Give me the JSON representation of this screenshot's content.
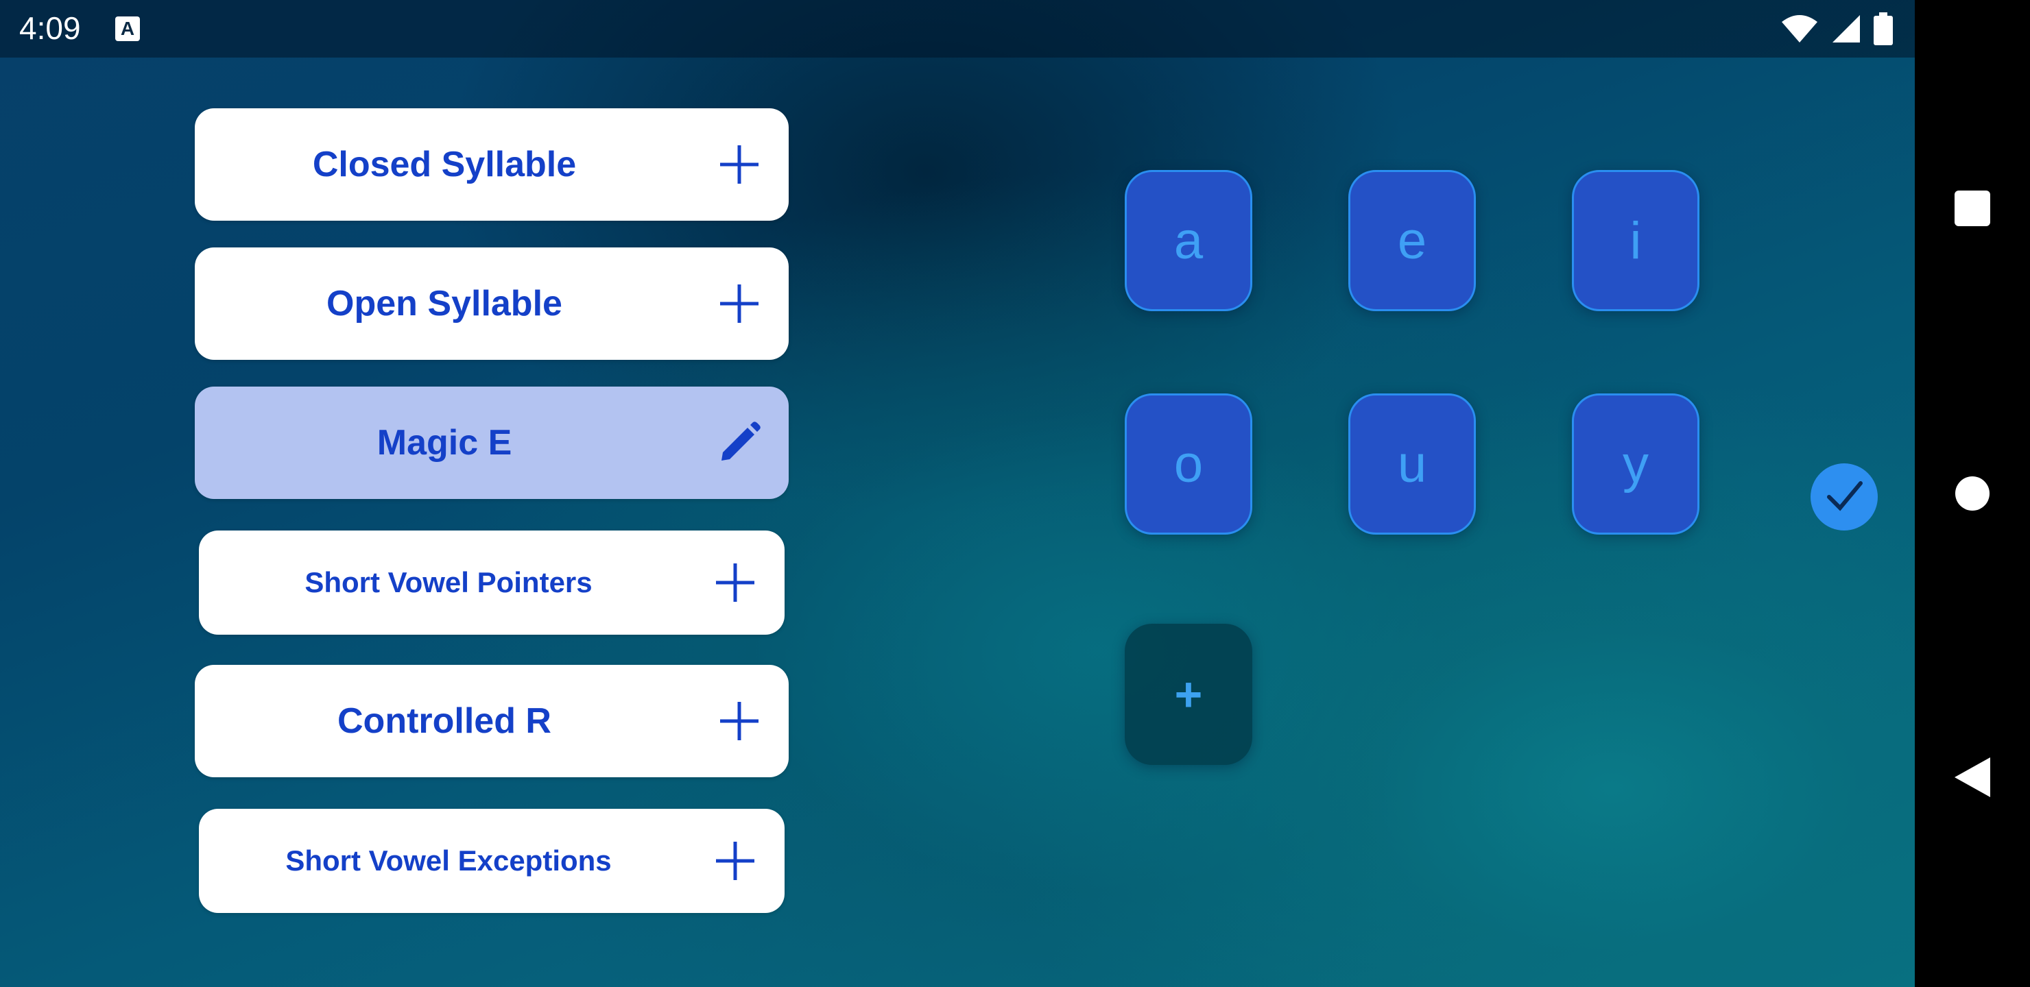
{
  "status": {
    "time": "4:09",
    "badge": "A"
  },
  "list": [
    {
      "label": "Closed Syllable",
      "action": "add"
    },
    {
      "label": "Open Syllable",
      "action": "add"
    },
    {
      "label": "Magic E",
      "action": "edit",
      "selected": true
    },
    {
      "label": "Short Vowel Pointers",
      "action": "add"
    },
    {
      "label": "Controlled R",
      "action": "add"
    },
    {
      "label": "Short Vowel Exceptions",
      "action": "add"
    }
  ],
  "tiles": [
    "a",
    "e",
    "i",
    "o",
    "u",
    "y"
  ],
  "add_tile": "+",
  "icons": {
    "add": "plus-icon",
    "edit": "pencil-icon",
    "confirm": "checkmark-icon"
  },
  "colors": {
    "accent": "#1440c8",
    "tile": "#2451c6",
    "tile_text": "#3fa0f5",
    "selected": "#b3c3f1"
  }
}
